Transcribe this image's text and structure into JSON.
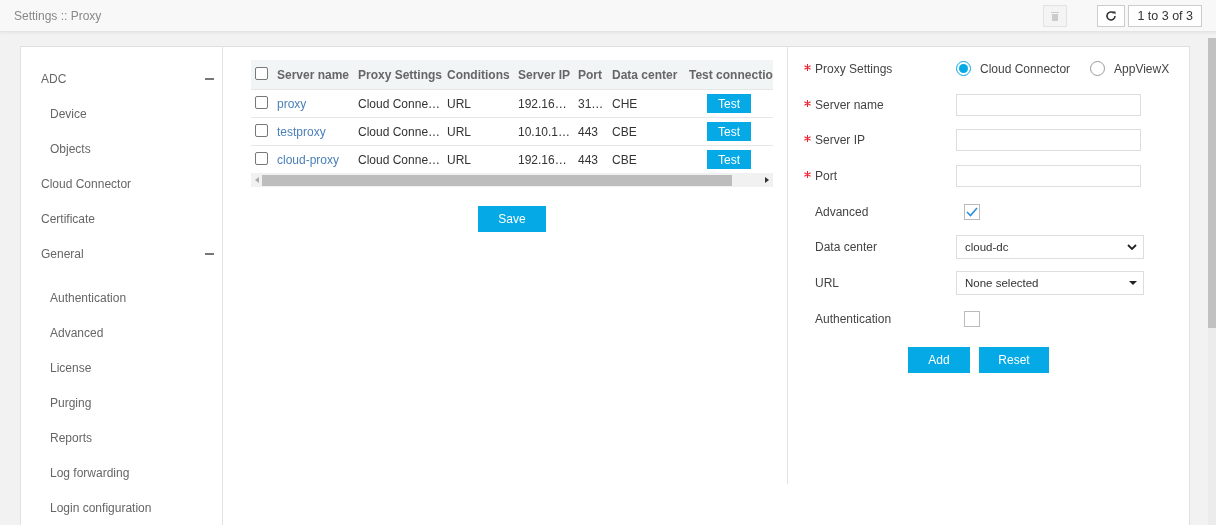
{
  "header": {
    "breadcrumb": "Settings :: Proxy",
    "pager": "1 to 3 of 3"
  },
  "sidebar": {
    "items": [
      {
        "label": "ADC",
        "expanded": true,
        "children": [
          {
            "label": "Device"
          },
          {
            "label": "Objects"
          }
        ]
      },
      {
        "label": "Cloud Connector"
      },
      {
        "label": "Certificate"
      },
      {
        "label": "General",
        "expanded": true,
        "children": [
          {
            "label": "Authentication"
          },
          {
            "label": "Advanced"
          },
          {
            "label": "License"
          },
          {
            "label": "Purging"
          },
          {
            "label": "Reports"
          },
          {
            "label": "Log forwarding"
          },
          {
            "label": "Login configuration"
          }
        ]
      }
    ]
  },
  "table": {
    "select_all_checked": false,
    "columns": [
      "Server name",
      "Proxy Settings",
      "Conditions",
      "Server IP",
      "Port",
      "Data center",
      "Test connectio"
    ],
    "rows": [
      {
        "checked": false,
        "cells": [
          "proxy",
          "Cloud Conne…",
          "URL",
          "192.16…",
          "31…",
          "CHE"
        ],
        "action": "Test"
      },
      {
        "checked": false,
        "cells": [
          "testproxy",
          "Cloud Conne…",
          "URL",
          "10.10.1…",
          "443",
          "CBE"
        ],
        "action": "Test"
      },
      {
        "checked": false,
        "cells": [
          "cloud-proxy",
          "Cloud Conne…",
          "URL",
          "192.16…",
          "443",
          "CBE"
        ],
        "action": "Test"
      }
    ]
  },
  "save_button": "Save",
  "form": {
    "fields": [
      {
        "kind": "radio",
        "label": "Proxy Settings",
        "required": true,
        "options": [
          {
            "label": "Cloud Connector",
            "selected": true
          },
          {
            "label": "AppViewX",
            "selected": false
          }
        ]
      },
      {
        "kind": "text",
        "label": "Server name",
        "required": true
      },
      {
        "kind": "text",
        "label": "Server IP",
        "required": true
      },
      {
        "kind": "text",
        "label": "Port",
        "required": true
      },
      {
        "kind": "checkbox",
        "label": "Advanced",
        "required": false,
        "checked": true
      },
      {
        "kind": "select",
        "label": "Data center",
        "required": false,
        "value": "cloud-dc"
      },
      {
        "kind": "dropdown",
        "label": "URL",
        "required": false,
        "value": "None selected"
      },
      {
        "kind": "checkbox",
        "label": "Authentication",
        "required": false,
        "checked": false
      }
    ],
    "buttons": [
      "Add",
      "Reset"
    ]
  }
}
